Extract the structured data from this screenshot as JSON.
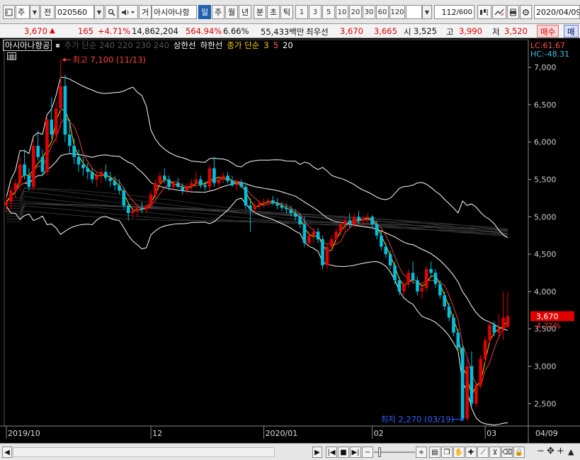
{
  "toolbar": {
    "period_type": "주",
    "prev_label": "전",
    "stock_code": "020560",
    "trade_label": "거",
    "stock_name": "아시아나항",
    "periods": [
      "일",
      "주",
      "월",
      "년",
      "분",
      "초",
      "틱"
    ],
    "active_period": "일",
    "intervals": [
      "1",
      "3",
      "5",
      "10",
      "20",
      "30",
      "60",
      "120"
    ],
    "count": "112",
    "count_max": "/600",
    "date": "2020/04/09"
  },
  "price_strip": {
    "price": "3,670",
    "change_arrow": "▲",
    "change": "165",
    "change_pct": "+4.71%",
    "volume": "14,862,204",
    "volume_ratio": "564.94%",
    "turnover": "6.66%",
    "amount": "55,433백만",
    "best_label": "최우선",
    "best_ask": "3,670",
    "best_bid": "3,665",
    "open_label": "시",
    "open": "3,525",
    "high_label": "고",
    "high": "3,990",
    "low_label": "저",
    "low": "3,520",
    "buy_label": "매수",
    "sell_label": "매"
  },
  "legend": {
    "stock_name": "아시아나항공",
    "ma_text": "주가 단순 240 220 230 240",
    "upper_limit": "상한선",
    "lower_limit": "하한선",
    "ma_label": "종가 단순",
    "ma_periods": [
      "3",
      "5",
      "20"
    ]
  },
  "indicators": {
    "lc": "LC:61.67",
    "hc": "HC:-48.31"
  },
  "annotations": {
    "high": "최고 7,100 (11/13)",
    "low": "최저 2,270 (03/19)"
  },
  "current": {
    "price": "3,670",
    "change_pct": "4.71%"
  },
  "bottom_bar": {
    "zoom_minus": "−",
    "zoom_plus": "+",
    "plus": "+",
    "minus": "−",
    "lock": "🔒"
  },
  "colors": {
    "up": "#e00000",
    "down": "#00c0e0",
    "ma3": "#f4d400",
    "ma5": "#e04040",
    "ma20": "#ffffff",
    "band": "#ffffff"
  },
  "chart_data": {
    "type": "candlestick",
    "ylim": [
      2200,
      7200
    ],
    "yticks": [
      "7,000",
      "6,500",
      "6,000",
      "5,500",
      "5,000",
      "4,500",
      "4,000",
      "3,500",
      "3,000",
      "2,500"
    ],
    "ytick_values": [
      7000,
      6500,
      6000,
      5500,
      5000,
      4500,
      4000,
      3500,
      3000,
      2500
    ],
    "xticks": [
      "2019/10",
      "12",
      "2020/01",
      "02",
      "03",
      "04"
    ],
    "xtick_index": [
      0,
      32,
      57,
      81,
      106,
      131
    ],
    "date_label": "04/09",
    "candles": [
      [
        5150,
        5280,
        5050,
        5200
      ],
      [
        5200,
        5400,
        5100,
        5350
      ],
      [
        5350,
        5500,
        5250,
        5450
      ],
      [
        5450,
        5800,
        5350,
        5700
      ],
      [
        5700,
        5900,
        5500,
        5550
      ],
      [
        5550,
        5650,
        5350,
        5400
      ],
      [
        5400,
        6050,
        5350,
        5950
      ],
      [
        5950,
        6150,
        5750,
        5800
      ],
      [
        5800,
        5900,
        5550,
        5600
      ],
      [
        5600,
        6350,
        5550,
        6300
      ],
      [
        6300,
        6600,
        6050,
        6100
      ],
      [
        6100,
        6550,
        6000,
        6450
      ],
      [
        6450,
        7100,
        6200,
        6750
      ],
      [
        6750,
        6900,
        6000,
        6100
      ],
      [
        6100,
        6300,
        5850,
        5950
      ],
      [
        5950,
        6050,
        5700,
        5800
      ],
      [
        5800,
        5900,
        5600,
        5700
      ],
      [
        5700,
        5800,
        5550,
        5650
      ],
      [
        5650,
        5720,
        5500,
        5600
      ],
      [
        5600,
        5650,
        5450,
        5500
      ],
      [
        5500,
        5600,
        5400,
        5550
      ],
      [
        5550,
        5650,
        5450,
        5600
      ],
      [
        5600,
        5700,
        5480,
        5520
      ],
      [
        5520,
        5600,
        5400,
        5480
      ],
      [
        5480,
        5550,
        5350,
        5420
      ],
      [
        5420,
        5500,
        5300,
        5350
      ],
      [
        5350,
        5400,
        5100,
        5150
      ],
      [
        5150,
        5200,
        4950,
        5050
      ],
      [
        5050,
        5120,
        4980,
        5080
      ],
      [
        5080,
        5150,
        5000,
        5120
      ],
      [
        5120,
        5200,
        5050,
        5100
      ],
      [
        5100,
        5180,
        5050,
        5150
      ],
      [
        5150,
        5350,
        5100,
        5300
      ],
      [
        5300,
        5500,
        5250,
        5450
      ],
      [
        5450,
        5600,
        5400,
        5550
      ],
      [
        5550,
        5650,
        5450,
        5500
      ],
      [
        5500,
        5550,
        5350,
        5400
      ],
      [
        5400,
        5480,
        5350,
        5450
      ],
      [
        5450,
        5520,
        5380,
        5400
      ],
      [
        5400,
        5450,
        5300,
        5350
      ],
      [
        5350,
        5450,
        5300,
        5400
      ],
      [
        5400,
        5500,
        5350,
        5450
      ],
      [
        5450,
        5600,
        5400,
        5500
      ],
      [
        5500,
        5550,
        5380,
        5420
      ],
      [
        5420,
        5480,
        5350,
        5400
      ],
      [
        5400,
        5700,
        5350,
        5650
      ],
      [
        5650,
        5800,
        5400,
        5450
      ],
      [
        5450,
        5550,
        5350,
        5500
      ],
      [
        5500,
        5600,
        5450,
        5550
      ],
      [
        5550,
        5600,
        5450,
        5480
      ],
      [
        5480,
        5550,
        5400,
        5420
      ],
      [
        5420,
        5500,
        5350,
        5450
      ],
      [
        5450,
        5500,
        5380,
        5400
      ],
      [
        5400,
        5450,
        5100,
        5150
      ],
      [
        5150,
        5250,
        4800,
        5100
      ],
      [
        5100,
        5200,
        5050,
        5150
      ],
      [
        5150,
        5220,
        5100,
        5180
      ],
      [
        5180,
        5250,
        5120,
        5200
      ],
      [
        5200,
        5250,
        5150,
        5220
      ],
      [
        5220,
        5280,
        5150,
        5180
      ],
      [
        5180,
        5250,
        5100,
        5150
      ],
      [
        5150,
        5200,
        5080,
        5120
      ],
      [
        5120,
        5180,
        5050,
        5100
      ],
      [
        5100,
        5150,
        5000,
        5050
      ],
      [
        5050,
        5100,
        4950,
        5000
      ],
      [
        5000,
        5050,
        4850,
        4900
      ],
      [
        4900,
        5000,
        4600,
        4650
      ],
      [
        4650,
        4800,
        4600,
        4750
      ],
      [
        4750,
        4850,
        4650,
        4800
      ],
      [
        4800,
        4850,
        4650,
        4700
      ],
      [
        4700,
        4750,
        4300,
        4350
      ],
      [
        4350,
        4650,
        4300,
        4600
      ],
      [
        4600,
        4750,
        4550,
        4700
      ],
      [
        4700,
        4850,
        4650,
        4800
      ],
      [
        4800,
        4950,
        4750,
        4900
      ],
      [
        4900,
        5000,
        4800,
        4950
      ],
      [
        4950,
        5050,
        4850,
        4900
      ],
      [
        4900,
        5050,
        4850,
        5000
      ],
      [
        5000,
        5080,
        4900,
        4950
      ],
      [
        4950,
        5020,
        4880,
        4980
      ],
      [
        4980,
        5050,
        4900,
        5000
      ],
      [
        5000,
        5020,
        4850,
        4900
      ],
      [
        4900,
        4950,
        4700,
        4750
      ],
      [
        4750,
        4800,
        4550,
        4600
      ],
      [
        4600,
        4650,
        4450,
        4500
      ],
      [
        4500,
        4550,
        4300,
        4350
      ],
      [
        4350,
        4400,
        4100,
        4150
      ],
      [
        4150,
        4200,
        3950,
        4000
      ],
      [
        4000,
        4150,
        3950,
        4100
      ],
      [
        4100,
        4300,
        4050,
        4250
      ],
      [
        4250,
        4400,
        4100,
        4150
      ],
      [
        4150,
        4200,
        3950,
        4000
      ],
      [
        4000,
        4100,
        3900,
        4050
      ],
      [
        4050,
        4350,
        4000,
        4300
      ],
      [
        4300,
        4400,
        4200,
        4250
      ],
      [
        4250,
        4300,
        4050,
        4100
      ],
      [
        4100,
        4150,
        3900,
        3950
      ],
      [
        3950,
        4000,
        3750,
        3800
      ],
      [
        3800,
        3850,
        3600,
        3650
      ],
      [
        3650,
        3700,
        3400,
        3450
      ],
      [
        3450,
        3500,
        3200,
        3250
      ],
      [
        3250,
        3300,
        2270,
        2300
      ],
      [
        2300,
        3100,
        2270,
        3000
      ],
      [
        3000,
        3200,
        2450,
        2500
      ],
      [
        2500,
        2800,
        2450,
        2750
      ],
      [
        2750,
        3150,
        2700,
        3100
      ],
      [
        3100,
        3400,
        3050,
        3350
      ],
      [
        3350,
        3600,
        3300,
        3550
      ],
      [
        3550,
        3600,
        3400,
        3450
      ],
      [
        3450,
        3700,
        3400,
        3500
      ],
      [
        3500,
        4000,
        3350,
        3650
      ],
      [
        3525,
        3990,
        3520,
        3670
      ]
    ]
  }
}
